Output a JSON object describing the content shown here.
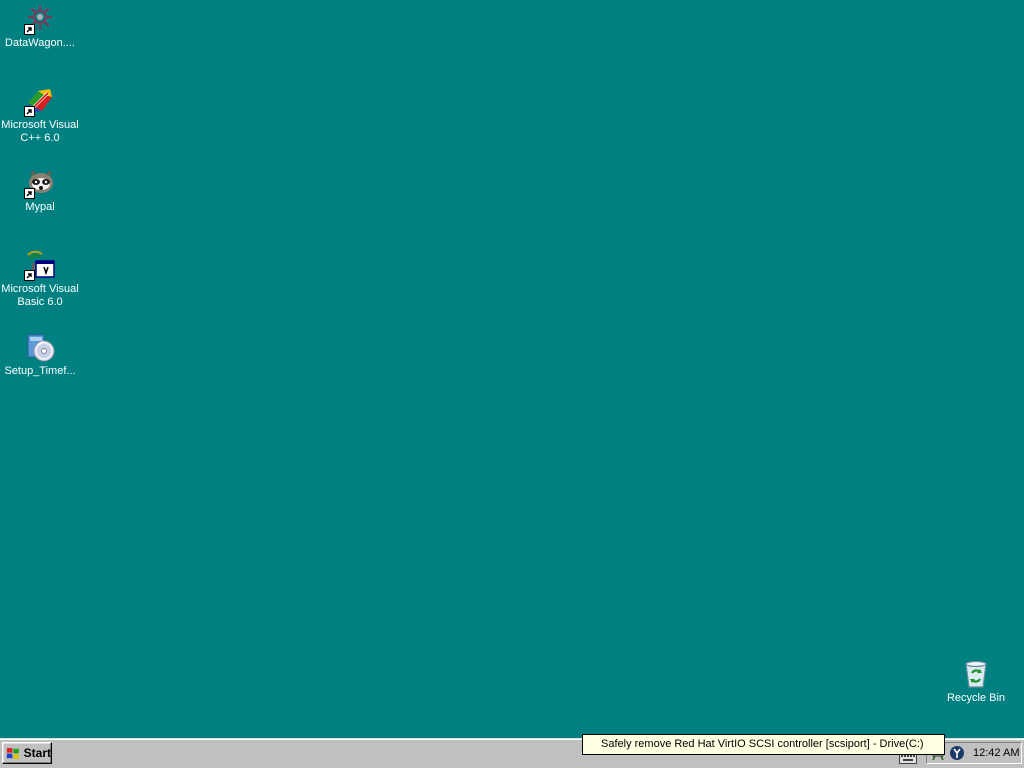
{
  "desktop": {
    "background_color": "#008080",
    "icons": [
      {
        "label": "DataWagon....",
        "icon": "datawagon-icon",
        "shortcut": true
      },
      {
        "label": "Microsoft Visual C++ 6.0",
        "icon": "visual-cpp-icon",
        "shortcut": true
      },
      {
        "label": "Mypal",
        "icon": "mypal-icon",
        "shortcut": true
      },
      {
        "label": "Microsoft Visual Basic 6.0",
        "icon": "visual-basic-icon",
        "shortcut": true
      },
      {
        "label": "Setup_Timef...",
        "icon": "setup-installer-icon",
        "shortcut": false
      }
    ],
    "recycle_bin": {
      "label": "Recycle Bin",
      "icon": "recycle-bin-icon"
    }
  },
  "taskbar": {
    "start_label": "Start",
    "tooltip": "Safely remove Red Hat VirtIO SCSI controller [scsiport] - Drive(C:)",
    "clock": "12:42 AM",
    "tray_icons": [
      "keyboard-icon",
      "safely-remove-hardware-icon",
      "network-icon"
    ]
  }
}
